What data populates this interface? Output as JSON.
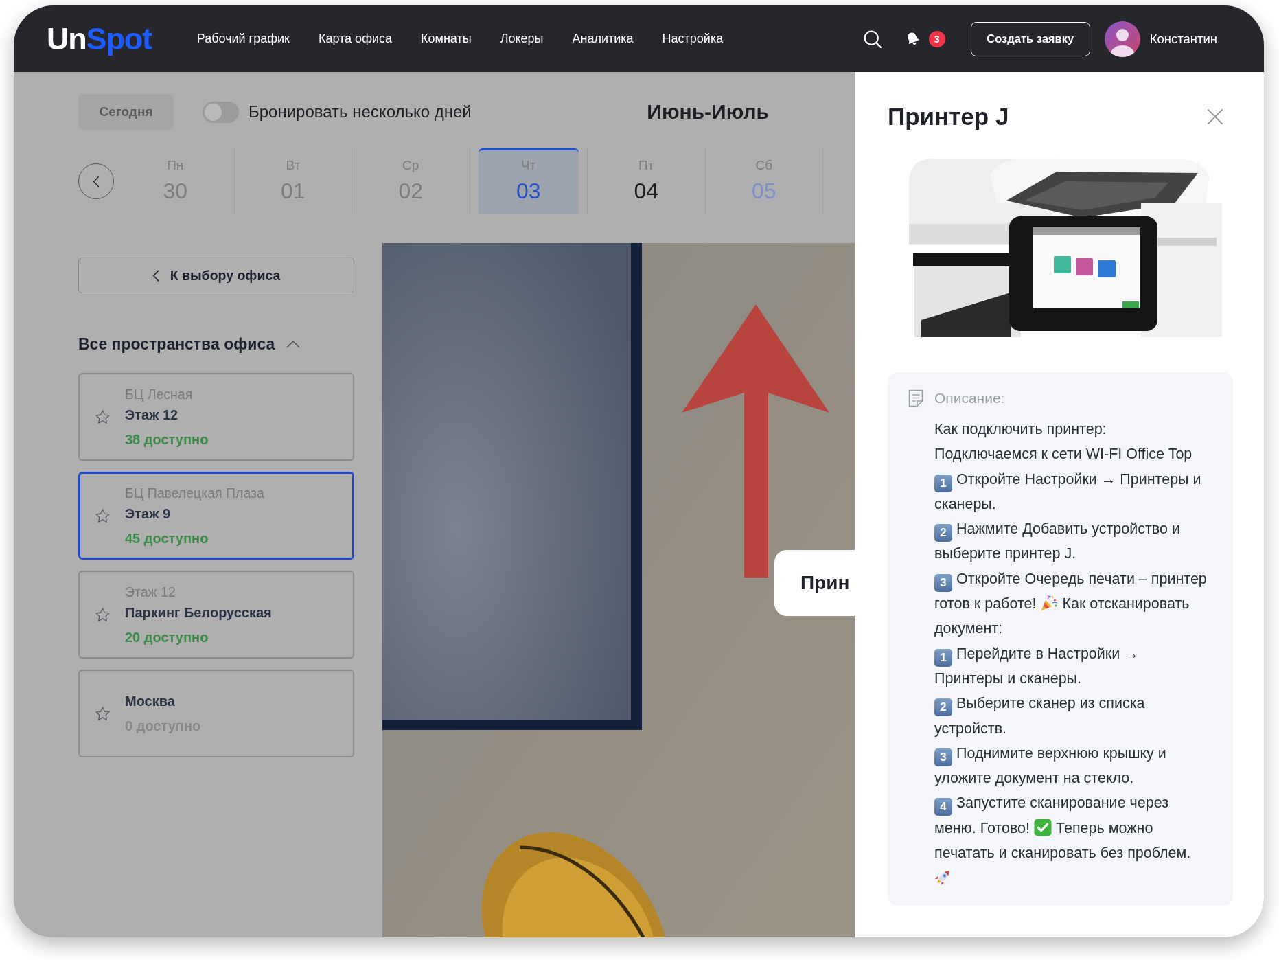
{
  "header": {
    "logo": [
      {
        "text": "Un",
        "color": "#ffffff"
      },
      {
        "text": "Spot",
        "color": "#1f5cff"
      }
    ],
    "nav": [
      "Рабочий график",
      "Карта офиса",
      "Комнаты",
      "Локеры",
      "Аналитика",
      "Настройка"
    ],
    "notifications": "3",
    "create_button": "Создать заявку",
    "user_name": "Константин"
  },
  "toolbar": {
    "today_button": {
      "label": "Сегодня",
      "disabled": true
    },
    "multi_day_toggle": {
      "label": "Бронировать несколько дней",
      "on": false
    },
    "month": "Июнь-Июль"
  },
  "calendar": {
    "days": [
      {
        "weekday": "Пн",
        "date": "30",
        "disabled": true,
        "weekend": false,
        "selected": false
      },
      {
        "weekday": "Вт",
        "date": "01",
        "disabled": true,
        "weekend": false,
        "selected": false
      },
      {
        "weekday": "Ср",
        "date": "02",
        "disabled": true,
        "weekend": false,
        "selected": false
      },
      {
        "weekday": "Чт",
        "date": "03",
        "disabled": false,
        "weekend": false,
        "selected": true
      },
      {
        "weekday": "Пт",
        "date": "04",
        "disabled": false,
        "weekend": false,
        "selected": false
      },
      {
        "weekday": "Сб",
        "date": "05",
        "disabled": false,
        "weekend": true,
        "selected": false
      }
    ]
  },
  "sidebar": {
    "back_button": "К выбору офиса",
    "section": {
      "title": "Все пространства офиса",
      "expanded": true,
      "offices": [
        {
          "building": "БЦ Лесная",
          "name": "Этаж 12",
          "availability": "38 доступно",
          "available": true,
          "favorite": false,
          "selected": false
        },
        {
          "building": "БЦ Павелецкая Плаза",
          "name": "Этаж 9",
          "availability": "45 доступно",
          "available": true,
          "favorite": false,
          "selected": true
        },
        {
          "building": "Этаж 12",
          "name": "Паркинг Белорусская",
          "availability": "20 доступно",
          "available": true,
          "favorite": false,
          "selected": false
        },
        {
          "name": "Москва",
          "availability": "0 доступно",
          "available": false,
          "favorite": false,
          "selected": false
        }
      ]
    }
  },
  "map": {
    "label": "Прин"
  },
  "details_panel": {
    "title": "Принтер J",
    "description": {
      "heading": "Описание:",
      "lines": [
        [
          {
            "kind": "text",
            "text": "Как подключить принтер:"
          }
        ],
        [
          {
            "kind": "text",
            "text": "Подключаемся к сети WI-FI Office Top"
          }
        ],
        [
          {
            "kind": "step",
            "text": "1"
          },
          {
            "kind": "text",
            "text": "Откройте Настройки → Принтеры и"
          }
        ],
        [
          {
            "kind": "text",
            "text": "сканеры."
          }
        ],
        [
          {
            "kind": "step",
            "text": "2"
          },
          {
            "kind": "text",
            "text": "Нажмите Добавить устройство и"
          }
        ],
        [
          {
            "kind": "text",
            "text": "выберите принтер J."
          }
        ],
        [
          {
            "kind": "step",
            "text": "3"
          },
          {
            "kind": "text",
            "text": "Откройте Очередь печати – принтер"
          }
        ],
        [
          {
            "kind": "text",
            "text": "готов к работе!"
          },
          {
            "kind": "party"
          },
          {
            "kind": "text",
            "text": "Как отсканировать"
          }
        ],
        [
          {
            "kind": "text",
            "text": "документ:"
          }
        ],
        [
          {
            "kind": "step",
            "text": "1"
          },
          {
            "kind": "text",
            "text": "Перейдите в Настройки →"
          }
        ],
        [
          {
            "kind": "text",
            "text": "Принтеры и сканеры."
          }
        ],
        [
          {
            "kind": "step",
            "text": "2"
          },
          {
            "kind": "text",
            "text": "Выберите сканер из списка"
          }
        ],
        [
          {
            "kind": "text",
            "text": "устройств."
          }
        ],
        [
          {
            "kind": "step",
            "text": "3"
          },
          {
            "kind": "text",
            "text": "Поднимите верхнюю крышку и"
          }
        ],
        [
          {
            "kind": "text",
            "text": "уложите документ на стекло."
          }
        ],
        [
          {
            "kind": "step",
            "text": "4"
          },
          {
            "kind": "text",
            "text": "Запустите сканирование через"
          }
        ],
        [
          {
            "kind": "text",
            "text": "меню. Готово!"
          },
          {
            "kind": "check"
          },
          {
            "kind": "text",
            "text": "Теперь можно"
          }
        ],
        [
          {
            "kind": "text",
            "text": "печатать и сканировать без проблем."
          }
        ],
        [
          {
            "kind": "rocket"
          }
        ]
      ]
    }
  }
}
